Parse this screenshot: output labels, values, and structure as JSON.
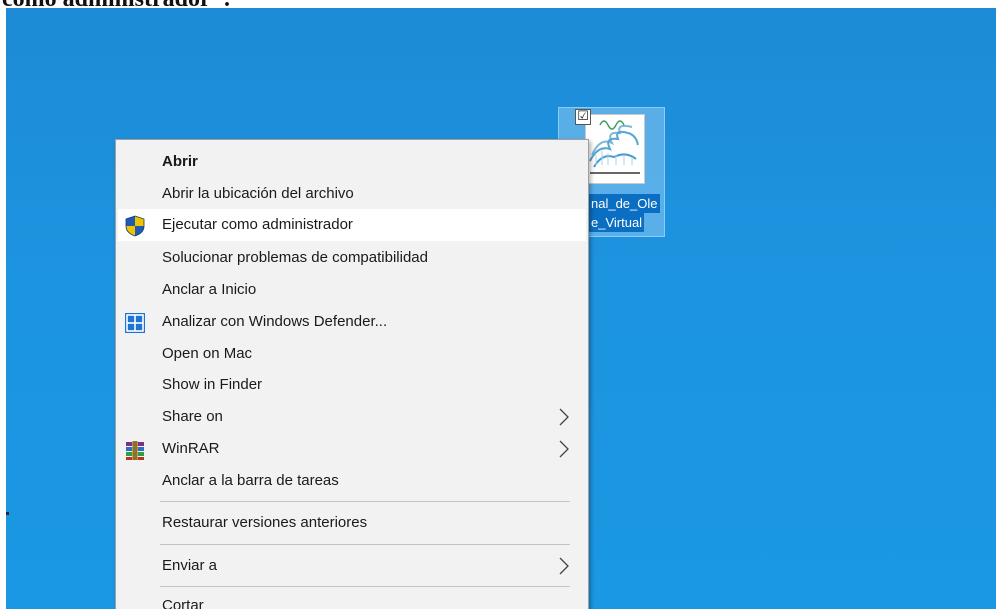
{
  "caption": {
    "text": "como administrador\"."
  },
  "desktop": {
    "shortcut": {
      "label_line1": "nal_de_Ole",
      "label_line2": "e_Virtual",
      "check_glyph": "☑",
      "icon": "wave-tank-shortcut-icon"
    }
  },
  "context_menu": {
    "items": [
      {
        "label": "Abrir",
        "bold": true
      },
      {
        "label": "Abrir la ubicación del archivo"
      },
      {
        "label": "Ejecutar como administrador",
        "icon": "uac-shield-icon",
        "highlighted": true
      },
      {
        "label": "Solucionar problemas de compatibilidad"
      },
      {
        "label": "Anclar a Inicio"
      },
      {
        "label": "Analizar con Windows Defender...",
        "icon": "windows-defender-icon"
      },
      {
        "label": "Open on Mac"
      },
      {
        "label": "Show in Finder"
      },
      {
        "label": "Share on",
        "submenu": true
      },
      {
        "label": "WinRAR",
        "icon": "winrar-icon",
        "submenu": true
      },
      {
        "label": "Anclar a la barra de tareas"
      },
      {
        "label": "Restaurar versiones anteriores"
      },
      {
        "label": "Enviar a",
        "submenu": true
      },
      {
        "label": "Cortar"
      }
    ]
  },
  "colors": {
    "desktop_background": "#1d8bd6",
    "menu_background": "#f2f2f2",
    "highlight": "#ffffff",
    "shield_blue": "#1e5cb3",
    "shield_yellow": "#f2c200",
    "defender_blue": "#1c74d4"
  }
}
